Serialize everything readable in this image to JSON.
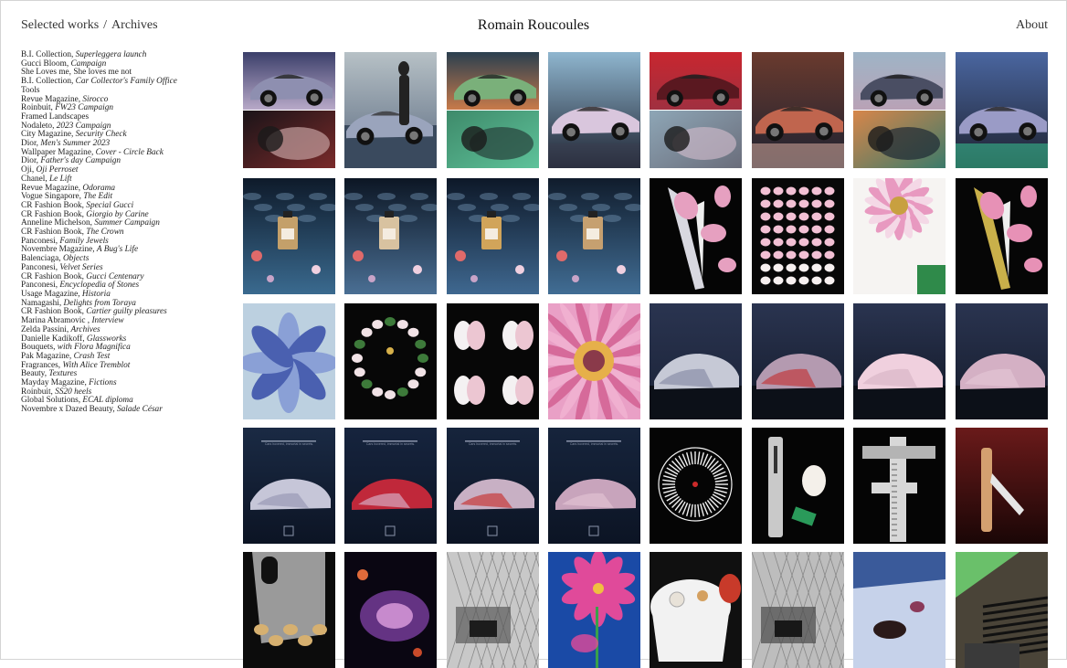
{
  "header": {
    "nav_selected": "Selected works",
    "nav_separator": "/",
    "nav_archives": "Archives",
    "site_title": "Romain Roucoules",
    "about": "About"
  },
  "projects": [
    {
      "client": "B.I. Collection, ",
      "title": "Superleggera launch"
    },
    {
      "client": "Gucci Bloom, ",
      "title": "Campaign"
    },
    {
      "client": "She Loves me, She loves me not",
      "title": ""
    },
    {
      "client": "B.I. Collection, ",
      "title": "Car Collector's Family Office"
    },
    {
      "client": "Tools",
      "title": ""
    },
    {
      "client": "Revue Magazine, ",
      "title": "Sirocco"
    },
    {
      "client": "Roinbuit, ",
      "title": "FW23 Campaign"
    },
    {
      "client": "Framed Landscapes",
      "title": ""
    },
    {
      "client": "Nodaleto, ",
      "title": "2023 Campaign"
    },
    {
      "client": "City Magazine, ",
      "title": "Security Check"
    },
    {
      "client": "Dior, ",
      "title": "Men's Summer 2023"
    },
    {
      "client": "Wallpaper Magazine, ",
      "title": "Cover - Circle Back"
    },
    {
      "client": "Dior, ",
      "title": "Father's day Campaign"
    },
    {
      "client": "Oji, ",
      "title": "Oji Perroset"
    },
    {
      "client": "Chanel, ",
      "title": "Le Lift"
    },
    {
      "client": "Revue Magazine, ",
      "title": "Odorama"
    },
    {
      "client": "Vogue Singapore, ",
      "title": "The Edit"
    },
    {
      "client": "CR Fashion Book, ",
      "title": "Special Gucci"
    },
    {
      "client": "CR Fashion Book, ",
      "title": "Giorgio by Carine"
    },
    {
      "client": "Anneline Michelson, ",
      "title": "Summer Campaign"
    },
    {
      "client": "CR Fashion Book, ",
      "title": "The Crown"
    },
    {
      "client": "Panconesi, ",
      "title": "Family Jewels"
    },
    {
      "client": "Novembre Magazine, ",
      "title": "A Bug's Life"
    },
    {
      "client": "Balenciaga, ",
      "title": "Objects"
    },
    {
      "client": "Panconesi, ",
      "title": "Velvet Series"
    },
    {
      "client": "CR Fashion Book, ",
      "title": "Gucci Centenary"
    },
    {
      "client": "Panconesi, ",
      "title": "Encyclopedia of Stones"
    },
    {
      "client": "Usage Magazine, ",
      "title": "Historia"
    },
    {
      "client": "Namagashi, ",
      "title": "Delights from Toraya"
    },
    {
      "client": "CR Fashion Book, ",
      "title": "Cartier guilty pleasures"
    },
    {
      "client": "Marina Abramovic , ",
      "title": "Interview"
    },
    {
      "client": "Zelda Passini, ",
      "title": "Archives"
    },
    {
      "client": "Danielle Kadikoff, ",
      "title": "Glassworks"
    },
    {
      "client": "Bouquets, ",
      "title": "with Flora Magnifica"
    },
    {
      "client": "Pak Magazine, ",
      "title": "Crash Test"
    },
    {
      "client": "Fragrances, ",
      "title": "With Alice Tremblot"
    },
    {
      "client": "Beauty, ",
      "title": "Textures"
    },
    {
      "client": "Mayday Magazine, ",
      "title": "Fictions"
    },
    {
      "client": "Roinbuit, ",
      "title": "SS20 heels"
    },
    {
      "client": "Global Solutions, ",
      "title": "ECAL diploma"
    },
    {
      "client": "Novembre x Dazed Beauty, ",
      "title": "Salade César"
    }
  ],
  "poster_caption": "Cars hovered, immortal in secrets.",
  "thumbnails": [
    {
      "name": "thumb-car-silver-interior",
      "kind": "split",
      "top": [
        "#3b3f6a",
        "#b8a9c8",
        "#8e8fb0"
      ],
      "bot": [
        "#1a1418",
        "#7a2a2a",
        "#c4a0a0"
      ]
    },
    {
      "name": "thumb-silhouette-car",
      "kind": "silhouette",
      "top": [
        "#b7c1c6",
        "#8e9aa3"
      ],
      "bot": [
        "#3a4a5e",
        "#6a7488"
      ]
    },
    {
      "name": "thumb-orange-green-car",
      "kind": "split",
      "top": [
        "#2a3f4f",
        "#c87a4a",
        "#7ab07a"
      ],
      "bot": [
        "#3e8a6a",
        "#5ec29a",
        "#27403a"
      ]
    },
    {
      "name": "thumb-pink-car-bluesky",
      "kind": "single",
      "top": [
        "#8fb6cf",
        "#d9c6dd",
        "#3a3e4f"
      ]
    },
    {
      "name": "thumb-red-grey-car",
      "kind": "split",
      "top": [
        "#c8262f",
        "#a03040",
        "#5a1820"
      ],
      "bot": [
        "#8ea6b6",
        "#6a6d7b",
        "#c9b6c6"
      ]
    },
    {
      "name": "thumb-car-interior-red",
      "kind": "single",
      "top": [
        "#6a3a2e",
        "#c0654e",
        "#e8b8a8"
      ]
    },
    {
      "name": "thumb-car-orange-sunset",
      "kind": "split",
      "top": [
        "#9eb4c6",
        "#b9a2b6",
        "#4a4e63"
      ],
      "bot": [
        "#d7864a",
        "#3b7a6a",
        "#1e2a34"
      ]
    },
    {
      "name": "thumb-car-blue-green",
      "kind": "single",
      "top": [
        "#4a66a0",
        "#9a9bc6",
        "#3ad19a"
      ]
    },
    {
      "name": "thumb-perfume-water-1",
      "kind": "water",
      "top": [
        "#0e1a2a",
        "#3a6a8f",
        "#c4a06a"
      ]
    },
    {
      "name": "thumb-perfume-water-2",
      "kind": "water",
      "top": [
        "#0c1624",
        "#4a6f94",
        "#d8c2a0"
      ]
    },
    {
      "name": "thumb-perfume-water-3",
      "kind": "water",
      "top": [
        "#0d1828",
        "#3f6890",
        "#d1a45a"
      ]
    },
    {
      "name": "thumb-perfume-water-4",
      "kind": "water",
      "top": [
        "#101c2c",
        "#416d94",
        "#c6a070"
      ]
    },
    {
      "name": "thumb-pink-petals-black",
      "kind": "petals",
      "top": [
        "#050505",
        "#e6a0c0",
        "#d8d8e0"
      ]
    },
    {
      "name": "thumb-petal-grid",
      "kind": "grid",
      "top": [
        "#080808",
        "#f2c0d4",
        "#f7f0f0"
      ]
    },
    {
      "name": "thumb-pink-gerbera",
      "kind": "flower",
      "top": [
        "#f4d8e6",
        "#e899c0",
        "#2f8a4a"
      ]
    },
    {
      "name": "thumb-scattered-petals",
      "kind": "petals",
      "top": [
        "#060606",
        "#e791b6",
        "#c9b04a"
      ]
    },
    {
      "name": "thumb-blue-petals",
      "kind": "bluepetals",
      "top": [
        "#bcd0e0",
        "#4a60b0",
        "#8aa0d6"
      ]
    },
    {
      "name": "thumb-flower-wreath",
      "kind": "wreath",
      "top": [
        "#070707",
        "#f1e2e6",
        "#3d7a3a"
      ]
    },
    {
      "name": "thumb-orchid-petals",
      "kind": "orchid",
      "top": [
        "#070707",
        "#ecc6d2",
        "#f4f1f2"
      ]
    },
    {
      "name": "thumb-gerbera-closeup",
      "kind": "gerbera",
      "top": [
        "#e9a0c6",
        "#d66a9a",
        "#8a3a4a"
      ]
    },
    {
      "name": "thumb-covered-car-1",
      "kind": "covered",
      "top": [
        "#1a2236",
        "#8a8fa8",
        "#c6c9d6"
      ]
    },
    {
      "name": "thumb-covered-car-2",
      "kind": "covered",
      "top": [
        "#141a2a",
        "#c03a40",
        "#b49ab0"
      ]
    },
    {
      "name": "thumb-covered-car-3",
      "kind": "covered",
      "top": [
        "#101624",
        "#d8b6c8",
        "#f0d0de"
      ]
    },
    {
      "name": "thumb-covered-cars-4",
      "kind": "covered",
      "top": [
        "#141a2a",
        "#e2c4d4",
        "#d4b0c4"
      ]
    },
    {
      "name": "thumb-poster-car-1",
      "kind": "poster",
      "top": [
        "#1a2a44",
        "#9a9ab6",
        "#c6c6d8"
      ]
    },
    {
      "name": "thumb-poster-car-2",
      "kind": "poster",
      "top": [
        "#16243e",
        "#d6a8c0",
        "#c0283a"
      ]
    },
    {
      "name": "thumb-poster-car-3",
      "kind": "poster",
      "top": [
        "#16243c",
        "#c63a3a",
        "#c8b0c4"
      ]
    },
    {
      "name": "thumb-poster-car-4",
      "kind": "poster",
      "top": [
        "#16243c",
        "#e0c0d2",
        "#c8a4bc"
      ]
    },
    {
      "name": "thumb-dial-tool",
      "kind": "dial",
      "top": [
        "#050505",
        "#f2f2f2",
        "#cc2a2a"
      ]
    },
    {
      "name": "thumb-egg-tools",
      "kind": "tools",
      "top": [
        "#050505",
        "#c9c9c9",
        "#2a9a5a"
      ]
    },
    {
      "name": "thumb-caliper",
      "kind": "caliper",
      "top": [
        "#050505",
        "#d8d8d8",
        "#b4b4b4"
      ]
    },
    {
      "name": "thumb-folding-knife",
      "kind": "knife",
      "top": [
        "#1a0606",
        "#6a1a1a",
        "#d4a070"
      ]
    },
    {
      "name": "thumb-razor-chips",
      "kind": "razor",
      "top": [
        "#0c0c0c",
        "#9a9a9a",
        "#d6b070"
      ]
    },
    {
      "name": "thumb-purple-splash",
      "kind": "splash",
      "top": [
        "#0a0612",
        "#7a3fa0",
        "#e0a0e0"
      ]
    },
    {
      "name": "thumb-bw-chain-fence",
      "kind": "bw",
      "top": [
        "#c8c8c8",
        "#5a5a5a",
        "#1c1c1c"
      ]
    },
    {
      "name": "thumb-pink-flower-blue",
      "kind": "pinkflower",
      "top": [
        "#1a4aa6",
        "#e04a9a",
        "#3aa04a"
      ]
    },
    {
      "name": "thumb-tea-table",
      "kind": "table",
      "top": [
        "#101010",
        "#f2f2f2",
        "#c83a2a"
      ]
    },
    {
      "name": "thumb-bw-cart",
      "kind": "bw",
      "top": [
        "#bdbdbd",
        "#4a4a4a",
        "#181818"
      ]
    },
    {
      "name": "thumb-blue-bedsheet",
      "kind": "bed",
      "top": [
        "#3a5a9a",
        "#c6d2ea",
        "#2a1a1a"
      ]
    },
    {
      "name": "thumb-umbrella-chair",
      "kind": "umbrella",
      "top": [
        "#2a2a2a",
        "#6ac06a",
        "#f0e8d0"
      ]
    }
  ]
}
